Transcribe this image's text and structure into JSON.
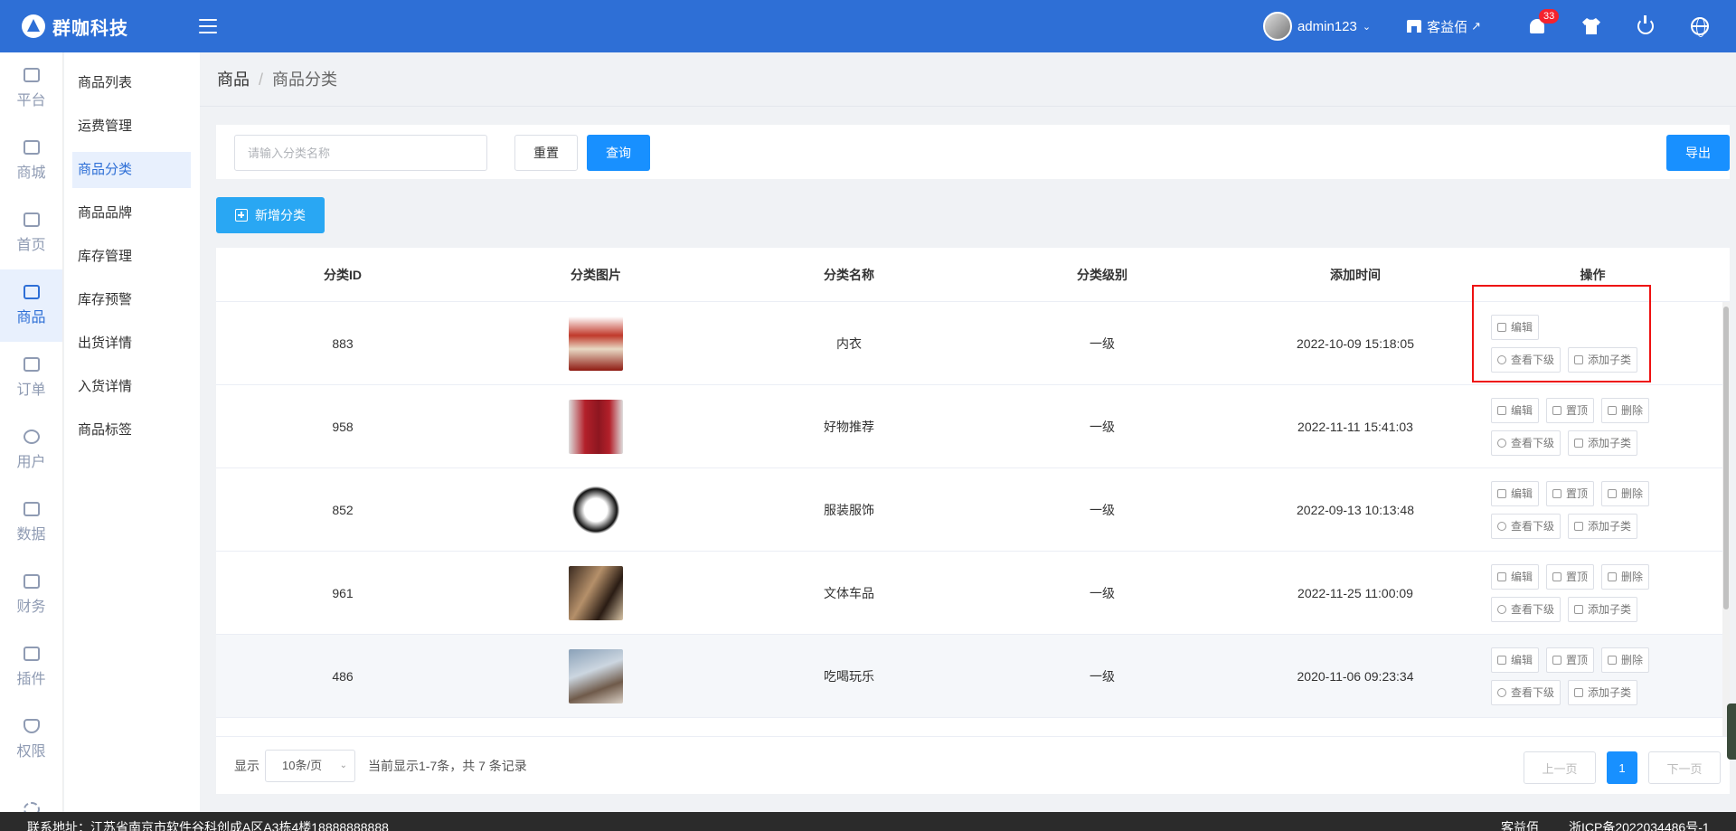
{
  "header": {
    "logo_text": "群咖科技",
    "username": "admin123",
    "store_name": "客益佰",
    "notification_count": "33"
  },
  "rail": [
    {
      "label": "平台",
      "icon": "monitor-icon"
    },
    {
      "label": "商城",
      "icon": "store-icon"
    },
    {
      "label": "首页",
      "icon": "home-icon"
    },
    {
      "label": "商品",
      "icon": "bag-icon"
    },
    {
      "label": "订单",
      "icon": "order-icon"
    },
    {
      "label": "用户",
      "icon": "user-icon"
    },
    {
      "label": "数据",
      "icon": "chart-icon"
    },
    {
      "label": "财务",
      "icon": "wallet-icon"
    },
    {
      "label": "插件",
      "icon": "puzzle-icon"
    },
    {
      "label": "权限",
      "icon": "shield-icon"
    }
  ],
  "submenu": [
    "商品列表",
    "运费管理",
    "商品分类",
    "商品品牌",
    "库存管理",
    "库存预警",
    "出货详情",
    "入货详情",
    "商品标签"
  ],
  "breadcrumb": {
    "root": "商品",
    "sep": "/",
    "current": "商品分类"
  },
  "filter": {
    "search_placeholder": "请输入分类名称",
    "reset_label": "重置",
    "query_label": "查询",
    "export_label": "导出"
  },
  "add_label": "新增分类",
  "table": {
    "headers": [
      "分类ID",
      "分类图片",
      "分类名称",
      "分类级别",
      "添加时间",
      "操作"
    ],
    "rows": [
      {
        "id": "883",
        "name": "内衣",
        "level": "一级",
        "time": "2022-10-09 15:18:05"
      },
      {
        "id": "958",
        "name": "好物推荐",
        "level": "一级",
        "time": "2022-11-11 15:41:03"
      },
      {
        "id": "852",
        "name": "服装服饰",
        "level": "一级",
        "time": "2022-09-13 10:13:48"
      },
      {
        "id": "961",
        "name": "文体车品",
        "level": "一级",
        "time": "2022-11-25 11:00:09"
      },
      {
        "id": "486",
        "name": "吃喝玩乐",
        "level": "一级",
        "time": "2020-11-06 09:23:34"
      }
    ],
    "ops": {
      "edit": "编辑",
      "top": "置顶",
      "delete": "删除",
      "view_children": "查看下级",
      "add_child": "添加子类"
    }
  },
  "pager": {
    "show_label": "显示",
    "page_size": "10条/页",
    "summary": "当前显示1-7条，共 7 条记录",
    "prev": "上一页",
    "current": "1",
    "next": "下一页"
  },
  "footer": {
    "address": "联系地址：江苏省南京市软件谷科创成A区A3栋4楼18888888888",
    "company": "客益佰",
    "icp": "浙ICP备2022034486号-1"
  },
  "colors": {
    "brand": "#2e6fd6",
    "primary": "#1890ff",
    "highlight": "#ee1111"
  }
}
